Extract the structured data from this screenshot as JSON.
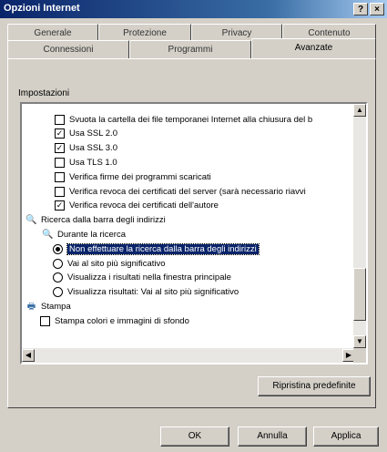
{
  "window": {
    "title": "Opzioni Internet",
    "help_label": "?",
    "close_label": "×"
  },
  "tabs": {
    "row1": [
      "Generale",
      "Protezione",
      "Privacy",
      "Contenuto"
    ],
    "row2": [
      "Connessioni",
      "Programmi",
      "Avanzate"
    ]
  },
  "section_label": "Impostazioni",
  "settings": {
    "items": [
      {
        "type": "checkbox",
        "checked": false,
        "label": "Svuota la cartella dei file temporanei Internet alla chiusura del b"
      },
      {
        "type": "checkbox",
        "checked": true,
        "label": "Usa SSL 2.0"
      },
      {
        "type": "checkbox",
        "checked": true,
        "label": "Usa SSL 3.0"
      },
      {
        "type": "checkbox",
        "checked": false,
        "label": "Usa TLS 1.0"
      },
      {
        "type": "checkbox",
        "checked": false,
        "label": "Verifica firme dei programmi scaricati"
      },
      {
        "type": "checkbox",
        "checked": false,
        "label": "Verifica revoca dei certificati del server (sarà necessario riavvi"
      },
      {
        "type": "checkbox",
        "checked": true,
        "label": "Verifica revoca dei certificati dell'autore"
      },
      {
        "type": "group",
        "icon": "search-icon",
        "label": "Ricerca dalla barra degli indirizzi"
      },
      {
        "type": "group",
        "icon": "search-icon",
        "label": "Durante la ricerca"
      },
      {
        "type": "radio",
        "checked": true,
        "selected": true,
        "label": "Non effettuare la ricerca dalla barra degli indirizzi"
      },
      {
        "type": "radio",
        "checked": false,
        "label": "Vai al sito più significativo"
      },
      {
        "type": "radio",
        "checked": false,
        "label": "Visualizza i risultati nella finestra principale"
      },
      {
        "type": "radio",
        "checked": false,
        "label": "Visualizza risultati: Vai al sito più significativo"
      },
      {
        "type": "group",
        "icon": "printer-icon",
        "label": "Stampa"
      },
      {
        "type": "checkbox",
        "checked": false,
        "label": "Stampa colori e immagini di sfondo"
      }
    ]
  },
  "buttons": {
    "restore": "Ripristina predefinite",
    "ok": "OK",
    "cancel": "Annulla",
    "apply": "Applica"
  }
}
